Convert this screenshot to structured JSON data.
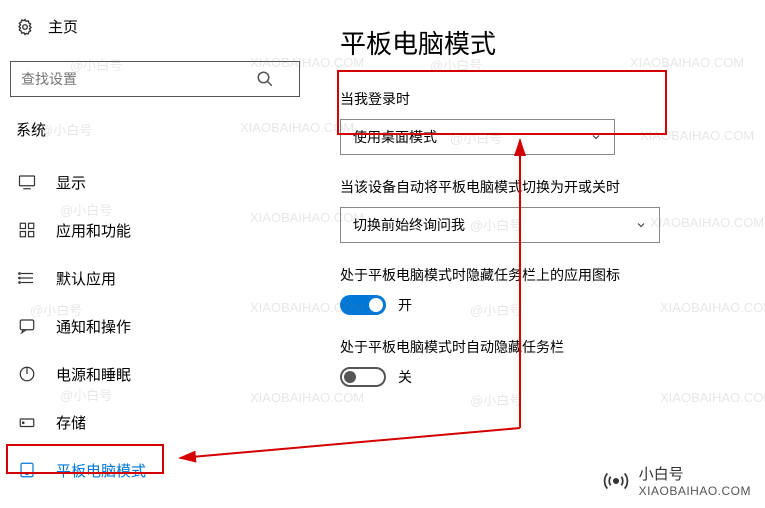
{
  "sidebar": {
    "home": "主页",
    "search_placeholder": "查找设置",
    "section": "系统",
    "items": [
      {
        "label": "显示"
      },
      {
        "label": "应用和功能"
      },
      {
        "label": "默认应用"
      },
      {
        "label": "通知和操作"
      },
      {
        "label": "电源和睡眠"
      },
      {
        "label": "存储"
      },
      {
        "label": "平板电脑模式"
      }
    ]
  },
  "main": {
    "title": "平板电脑模式",
    "signin_label": "当我登录时",
    "signin_value": "使用桌面模式",
    "switch_label": "当该设备自动将平板电脑模式切换为开或关时",
    "switch_value": "切换前始终询问我",
    "hide_icons_label": "处于平板电脑模式时隐藏任务栏上的应用图标",
    "hide_icons_value": "开",
    "hide_taskbar_label": "处于平板电脑模式时自动隐藏任务栏",
    "hide_taskbar_value": "关"
  },
  "watermark": {
    "brand": "小白号",
    "domain": "XIAOBAIHAO.COM",
    "at": "@小白号"
  }
}
